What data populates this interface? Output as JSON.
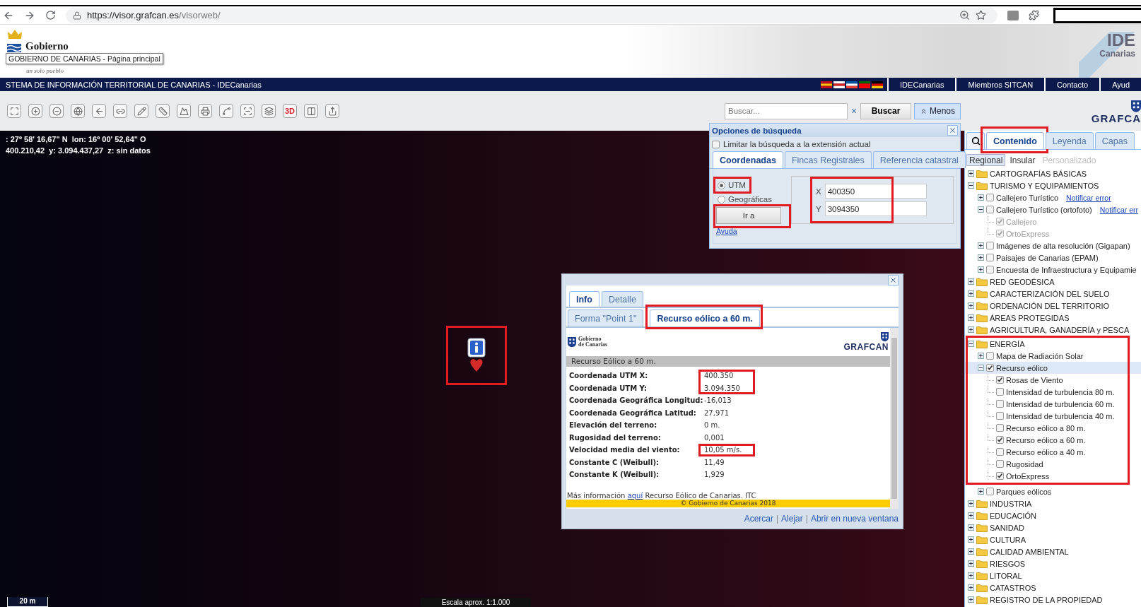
{
  "browser": {
    "url_host": "https://visor.grafcan.es",
    "url_path": "/visorweb/"
  },
  "header": {
    "logo_text": "Gobierno",
    "tooltip": "GOBIERNO DE CANARIAS - Página principal",
    "slogan": "un solo pueblo",
    "ide_logo": {
      "top": "IDE",
      "bottom": "Canarias"
    }
  },
  "nav": {
    "title": "STEMA DE INFORMACIÓN TERRITORIAL DE CANARIAS - IDECanarias",
    "links": [
      "IDECanarias",
      "Miembros SITCAN",
      "Contacto",
      "Ayud"
    ]
  },
  "toolbar": {
    "three_d": "3D",
    "search": {
      "placeholder": "Buscar...",
      "clear": "×",
      "button": "Buscar",
      "toggle": "Menos"
    },
    "brand": "GRAFCA"
  },
  "map": {
    "coords": [
      ": 27º 58' 16,67\" N  lon: 16º 00' 52,64\" O",
      "400.210,42  y: 3.094.437,27  z: sin datos"
    ],
    "marker": {
      "highlighted": true
    },
    "scale_bar": "20 m",
    "scale_text": "Escala aprox. 1:1.000"
  },
  "search_options": {
    "title": "Opciones de búsqueda",
    "limit": {
      "label": "Limitar la búsqueda a la extensión actual",
      "checked": false
    },
    "tabs": [
      {
        "label": "Coordenadas",
        "selected": true
      },
      {
        "label": "Fincas Registrales",
        "selected": false
      },
      {
        "label": "Referencia catastral",
        "selected": false
      }
    ],
    "radios": [
      {
        "label": "UTM",
        "selected": true,
        "highlighted": true
      },
      {
        "label": "Geográficas",
        "selected": false,
        "highlighted": false
      }
    ],
    "go": {
      "label": "Ir a",
      "highlighted": true
    },
    "help": "Ayuda",
    "fields": {
      "highlighted": true,
      "items": [
        {
          "label": "X",
          "value": "400350"
        },
        {
          "label": "Y",
          "value": "3094350"
        }
      ]
    }
  },
  "info_popup": {
    "tabs": [
      {
        "label": "Info",
        "selected": true
      },
      {
        "label": "Detalle",
        "selected": false
      }
    ],
    "subtabs": [
      {
        "label": "Forma \"Point 1\"",
        "selected": false,
        "highlighted": false
      },
      {
        "label": "Recurso eólico a 60 m.",
        "selected": true,
        "highlighted": true
      }
    ],
    "logo_left": {
      "top": "Gobierno",
      "bottom": "de Canarias"
    },
    "logo_right": "GRAFCAN",
    "section": "Recurso Eólico a 60 m.",
    "rows": [
      {
        "label": "Coordenada UTM X:",
        "value": "400.350",
        "highlighted": true
      },
      {
        "label": "Coordenada UTM Y:",
        "value": "3.094.350",
        "highlighted": true
      },
      {
        "label": "Coordenada Geográfica Longitud:",
        "value": "-16,013",
        "highlighted": false
      },
      {
        "label": "Coordenada Geográfica Latitud:",
        "value": "27,971",
        "highlighted": false
      },
      {
        "label": "Elevación del terreno:",
        "value": "0 m.",
        "highlighted": false
      },
      {
        "label": "Rugosidad del terreno:",
        "value": "0,001",
        "highlighted": false
      },
      {
        "label": "Velocidad media del viento:",
        "value": "10,05 m/s.",
        "highlighted": true
      },
      {
        "label": "Constante C (Weibull):",
        "value": "11,49",
        "highlighted": false
      },
      {
        "label": "Constante K (Weibull):",
        "value": "1,929",
        "highlighted": false
      }
    ],
    "footer": {
      "before": "Más información ",
      "link": "aquí",
      "after": " Recurso Eólico de Canarias. ITC"
    },
    "copyright": "© Gobierno de Canarias 2018",
    "actions": [
      {
        "kind": "link",
        "label": "Acercar"
      },
      {
        "kind": "separator",
        "label": "|"
      },
      {
        "kind": "link",
        "label": "Alejar"
      },
      {
        "kind": "separator",
        "label": "|"
      },
      {
        "kind": "link",
        "label": "Abrir en nueva ventana"
      }
    ]
  },
  "sidebar": {
    "tabs": [
      {
        "label": "Contenido",
        "selected": true,
        "highlighted": true
      },
      {
        "label": "Leyenda",
        "selected": false,
        "highlighted": false
      },
      {
        "label": "Capas",
        "selected": false,
        "highlighted": false
      }
    ],
    "scopes": [
      {
        "label": "Regional",
        "selected": true,
        "disabled": false
      },
      {
        "label": "Insular",
        "selected": false,
        "disabled": false
      },
      {
        "label": "Personalizado",
        "selected": false,
        "disabled": true
      }
    ],
    "tree": [
      {
        "kind": "folder",
        "label": "CARTOGRAFÍAS BÁSICAS",
        "expanded": false,
        "selected": false,
        "highlighted": false
      },
      {
        "kind": "folder",
        "label": "TURISMO Y EQUIPAMIENTOS",
        "expanded": true,
        "selected": false,
        "highlighted": false,
        "children": [
          {
            "kind": "layer",
            "label": "Callejero Turístico",
            "link": "Notificar error",
            "expanded": false,
            "checked": false,
            "disabled": false,
            "selected": false
          },
          {
            "kind": "layer",
            "label": "Callejero Turístico (ortofoto)",
            "link": "Notificar err",
            "expanded": true,
            "checked": false,
            "disabled": false,
            "selected": false,
            "children": [
              {
                "kind": "layer",
                "label": "Callejero",
                "checked": true,
                "disabled": true,
                "selected": false
              },
              {
                "kind": "layer",
                "label": "OrtoExpress",
                "checked": true,
                "disabled": true,
                "selected": false
              }
            ]
          },
          {
            "kind": "layer",
            "label": "Imágenes de alta resolución (Gigapan)",
            "expanded": false,
            "checked": false,
            "disabled": false,
            "selected": false
          },
          {
            "kind": "layer",
            "label": "Paisajes de Canarias (EPAM)",
            "expanded": false,
            "checked": false,
            "disabled": false,
            "selected": false
          },
          {
            "kind": "layer",
            "label": "Encuesta de Infraestructura y Equipamie",
            "expanded": false,
            "checked": false,
            "disabled": false,
            "selected": false
          }
        ]
      },
      {
        "kind": "folder",
        "label": "RED GEODÉSICA",
        "expanded": false,
        "selected": false,
        "highlighted": false
      },
      {
        "kind": "folder",
        "label": "CARACTERIZACIÓN DEL SUELO",
        "expanded": false,
        "selected": false,
        "highlighted": false
      },
      {
        "kind": "folder",
        "label": "ORDENACIÓN DEL TERRITORIO",
        "expanded": false,
        "selected": false,
        "highlighted": false
      },
      {
        "kind": "folder",
        "label": "ÁREAS PROTEGIDAS",
        "expanded": false,
        "selected": false,
        "highlighted": false
      },
      {
        "kind": "folder",
        "label": "AGRICULTURA, GANADERÍA y PESCA",
        "expanded": false,
        "selected": false,
        "highlighted": false
      },
      {
        "kind": "folder",
        "label": "ENERGÍA",
        "expanded": true,
        "selected": false,
        "highlighted": true,
        "children": [
          {
            "kind": "layer",
            "label": "Mapa de Radiación Solar",
            "expanded": false,
            "checked": false,
            "disabled": false,
            "selected": false
          },
          {
            "kind": "layer",
            "label": "Recurso eólico",
            "expanded": true,
            "checked": true,
            "disabled": false,
            "selected": true,
            "children": [
              {
                "kind": "layer",
                "label": "Rosas de Viento",
                "checked": true,
                "disabled": false,
                "selected": false
              },
              {
                "kind": "layer",
                "label": "Intensidad de turbulencia 80 m.",
                "checked": false,
                "disabled": false,
                "selected": false
              },
              {
                "kind": "layer",
                "label": "Intensidad de turbulencia 60 m.",
                "checked": false,
                "disabled": false,
                "selected": false
              },
              {
                "kind": "layer",
                "label": "Intensidad de turbulencia 40 m.",
                "checked": false,
                "disabled": false,
                "selected": false
              },
              {
                "kind": "layer",
                "label": "Recurso eólico a 80 m.",
                "checked": false,
                "disabled": false,
                "selected": false
              },
              {
                "kind": "layer",
                "label": "Recurso eólico a 60 m.",
                "checked": true,
                "disabled": false,
                "selected": false
              },
              {
                "kind": "layer",
                "label": "Recurso eólico a 40 m.",
                "checked": false,
                "disabled": false,
                "selected": false
              },
              {
                "kind": "layer",
                "label": "Rugosidad",
                "checked": false,
                "disabled": false,
                "selected": false
              },
              {
                "kind": "layer",
                "label": "OrtoExpress",
                "checked": true,
                "disabled": false,
                "selected": false
              }
            ]
          },
          {
            "kind": "layer",
            "label": "Parques eólicos",
            "expanded": false,
            "checked": false,
            "disabled": false,
            "selected": false
          }
        ]
      },
      {
        "kind": "folder",
        "label": "INDUSTRIA",
        "expanded": false,
        "selected": false,
        "highlighted": false
      },
      {
        "kind": "folder",
        "label": "EDUCACIÓN",
        "expanded": false,
        "selected": false,
        "highlighted": false
      },
      {
        "kind": "folder",
        "label": "SANIDAD",
        "expanded": false,
        "selected": false,
        "highlighted": false
      },
      {
        "kind": "folder",
        "label": "CULTURA",
        "expanded": false,
        "selected": false,
        "highlighted": false
      },
      {
        "kind": "folder",
        "label": "CALIDAD AMBIENTAL",
        "expanded": false,
        "selected": false,
        "highlighted": false
      },
      {
        "kind": "folder",
        "label": "RIESGOS",
        "expanded": false,
        "selected": false,
        "highlighted": false
      },
      {
        "kind": "folder",
        "label": "LITORAL",
        "expanded": false,
        "selected": false,
        "highlighted": false
      },
      {
        "kind": "folder",
        "label": "CATASTROS",
        "expanded": false,
        "selected": false,
        "highlighted": false
      },
      {
        "kind": "folder",
        "label": "REGISTRO DE LA PROPIEDAD",
        "expanded": false,
        "selected": false,
        "highlighted": false
      }
    ]
  }
}
